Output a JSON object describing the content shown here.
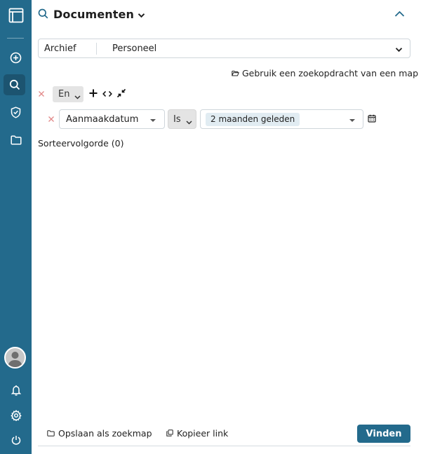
{
  "header": {
    "title": "Documenten"
  },
  "archive": {
    "label": "Archief",
    "value": "Personeel"
  },
  "folder_query_link": "Gebruik een zoekopdracht van een map",
  "logic": {
    "operator": "En"
  },
  "condition": {
    "field": "Aanmaakdatum",
    "comparator": "Is",
    "value": "2 maanden geleden"
  },
  "sort": {
    "label": "Sorteervolgorde (0)"
  },
  "footer": {
    "save_search_folder": "Opslaan als zoekmap",
    "copy_link": "Kopieer link",
    "find_button": "Vinden"
  },
  "colors": {
    "sidebar": "#236a8c",
    "accent": "#236a8c",
    "remove": "#e28a8a"
  },
  "icons": {
    "sidebar": [
      "app-logo-icon",
      "plus-circle-icon",
      "search-icon",
      "shield-icon",
      "folder-icon",
      "avatar",
      "bell-icon",
      "gear-icon",
      "power-icon"
    ]
  }
}
